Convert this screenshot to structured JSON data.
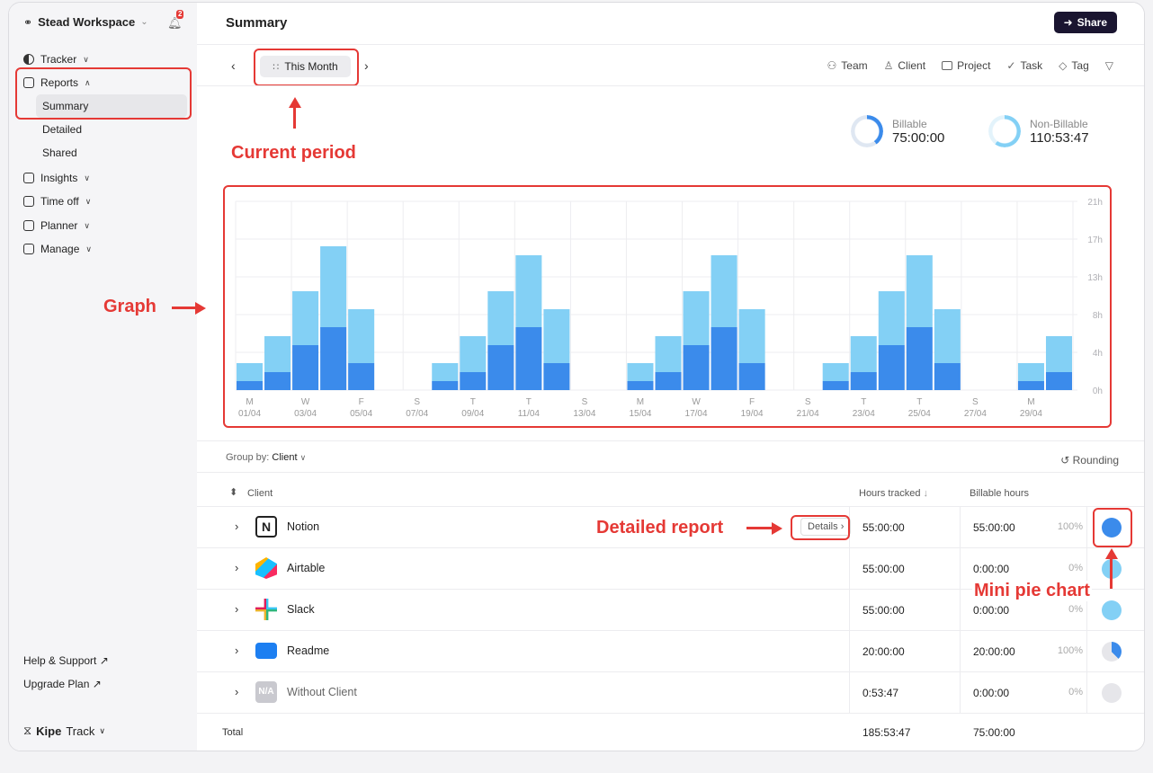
{
  "sidebar": {
    "workspace": "Stead Workspace",
    "notifications": "2",
    "items": [
      {
        "label": "Tracker"
      },
      {
        "label": "Reports"
      },
      {
        "label": "Summary"
      },
      {
        "label": "Detailed"
      },
      {
        "label": "Shared"
      },
      {
        "label": "Insights"
      },
      {
        "label": "Time off"
      },
      {
        "label": "Planner"
      },
      {
        "label": "Manage"
      }
    ],
    "help": "Help & Support ↗",
    "upgrade": "Upgrade Plan ↗",
    "brand_bold": "Kipe",
    "brand_rest": "Track"
  },
  "header": {
    "title": "Summary",
    "share": "Share"
  },
  "period": {
    "label": "This Month"
  },
  "filters": [
    "Team",
    "Client",
    "Project",
    "Task",
    "Tag"
  ],
  "stats": {
    "billable_label": "Billable",
    "billable_value": "75:00:00",
    "nonbillable_label": "Non-Billable",
    "nonbillable_value": "110:53:47"
  },
  "colors": {
    "billable": "#3b8beb",
    "nonbillable": "#83d0f5",
    "annotation": "#e53935"
  },
  "chart_data": {
    "type": "bar",
    "stacked": true,
    "y_ticks": [
      "21h",
      "17h",
      "13h",
      "8h",
      "4h",
      "0h"
    ],
    "ylim": [
      0,
      21
    ],
    "x_labels": [
      {
        "day": "M",
        "date": "01/04"
      },
      {
        "day": "W",
        "date": "03/04"
      },
      {
        "day": "F",
        "date": "05/04"
      },
      {
        "day": "S",
        "date": "07/04"
      },
      {
        "day": "T",
        "date": "09/04"
      },
      {
        "day": "T",
        "date": "11/04"
      },
      {
        "day": "S",
        "date": "13/04"
      },
      {
        "day": "M",
        "date": "15/04"
      },
      {
        "day": "W",
        "date": "17/04"
      },
      {
        "day": "F",
        "date": "19/04"
      },
      {
        "day": "S",
        "date": "21/04"
      },
      {
        "day": "T",
        "date": "23/04"
      },
      {
        "day": "T",
        "date": "25/04"
      },
      {
        "day": "S",
        "date": "27/04"
      },
      {
        "day": "M",
        "date": "29/04"
      }
    ],
    "days": [
      "01/04",
      "02/04",
      "03/04",
      "04/04",
      "05/04",
      "06/04",
      "07/04",
      "08/04",
      "09/04",
      "10/04",
      "11/04",
      "12/04",
      "13/04",
      "14/04",
      "15/04",
      "16/04",
      "17/04",
      "18/04",
      "19/04",
      "20/04",
      "21/04",
      "22/04",
      "23/04",
      "24/04",
      "25/04",
      "26/04",
      "27/04",
      "28/04",
      "29/04",
      "30/04"
    ],
    "series": [
      {
        "name": "Billable",
        "values": [
          1,
          2,
          5,
          7,
          3,
          0,
          0,
          1,
          2,
          5,
          7,
          3,
          0,
          0,
          1,
          2,
          5,
          7,
          3,
          0,
          0,
          1,
          2,
          5,
          7,
          3,
          0,
          0,
          1,
          2
        ]
      },
      {
        "name": "Non-Billable",
        "values": [
          2,
          4,
          6,
          9,
          6,
          0,
          0,
          2,
          4,
          6,
          8,
          6,
          0,
          0,
          2,
          4,
          6,
          8,
          6,
          0,
          0,
          2,
          4,
          6,
          8,
          6,
          0,
          0,
          2,
          4
        ]
      }
    ]
  },
  "annotations": {
    "period": "Current period",
    "graph": "Graph",
    "details": "Detailed report",
    "pie": "Mini pie chart"
  },
  "table": {
    "group_by_label": "Group by:",
    "group_by_value": "Client",
    "rounding": "Rounding",
    "headers": {
      "client": "Client",
      "hours": "Hours tracked",
      "billable": "Billable hours"
    },
    "details_label": "Details",
    "rows": [
      {
        "name": "Notion",
        "logo": "N",
        "hours": "55:00:00",
        "billable": "55:00:00",
        "pct": "100%"
      },
      {
        "name": "Airtable",
        "logo": "",
        "hours": "55:00:00",
        "billable": "0:00:00",
        "pct": "0%"
      },
      {
        "name": "Slack",
        "logo": "",
        "hours": "55:00:00",
        "billable": "0:00:00",
        "pct": "0%"
      },
      {
        "name": "Readme",
        "logo": "",
        "hours": "20:00:00",
        "billable": "20:00:00",
        "pct": "100%"
      },
      {
        "name": "Without Client",
        "logo": "N/A",
        "hours": "0:53:47",
        "billable": "0:00:00",
        "pct": "0%"
      }
    ],
    "total": {
      "label": "Total",
      "hours": "185:53:47",
      "billable": "75:00:00"
    }
  }
}
